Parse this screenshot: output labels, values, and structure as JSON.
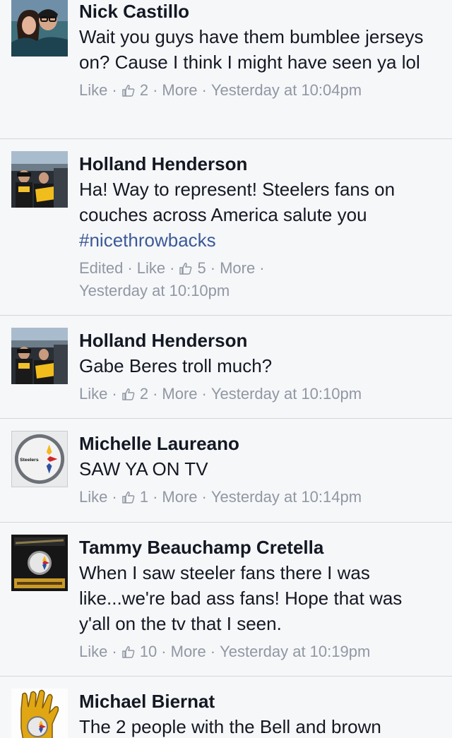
{
  "comments": [
    {
      "author": "Nick Castillo",
      "text": "Wait you guys have them bumblee jerseys on? Cause I think I might have seen ya lol",
      "actions": {
        "like": "Like",
        "likes": "2",
        "more": "More",
        "time": "Yesterday at 10:04pm"
      },
      "avatar_icon": "couple-selfie-photo"
    },
    {
      "author": "Holland Henderson",
      "text": "Ha! Way to represent! Steelers fans on couches across America salute you",
      "hashtag": "#nicethrowbacks",
      "actions": {
        "edited": "Edited",
        "like": "Like",
        "likes": "5",
        "more": "More",
        "time": "Yesterday at 10:10pm"
      },
      "avatar_icon": "stadium-fans-photo"
    },
    {
      "author": "Holland Henderson",
      "text": "Gabe Beres troll much?",
      "actions": {
        "like": "Like",
        "likes": "2",
        "more": "More",
        "time": "Yesterday at 10:10pm"
      },
      "avatar_icon": "stadium-fans-photo"
    },
    {
      "author": "Michelle Laureano",
      "text": "SAW YA ON TV",
      "actions": {
        "like": "Like",
        "likes": "1",
        "more": "More",
        "time": "Yesterday at 10:14pm"
      },
      "avatar_icon": "steelers-logo",
      "avatar_text": "Steelers"
    },
    {
      "author": "Tammy Beauchamp Cretella",
      "text": "When I saw steeler fans there I was like...we're bad ass fans! Hope that was y'all on the tv that I seen.",
      "actions": {
        "like": "Like",
        "likes": "10",
        "more": "More",
        "time": "Yesterday at 10:19pm"
      },
      "avatar_icon": "steelers-dark-logo"
    },
    {
      "author": "Michael Biernat",
      "text": "The 2 people with the Bell and brown",
      "avatar_icon": "steelers-glove-logo"
    }
  ],
  "colors": {
    "background": "#f6f7f9",
    "divider": "#d3d6db",
    "meta": "#9197a3",
    "link": "#3b5998",
    "text": "#141823"
  }
}
